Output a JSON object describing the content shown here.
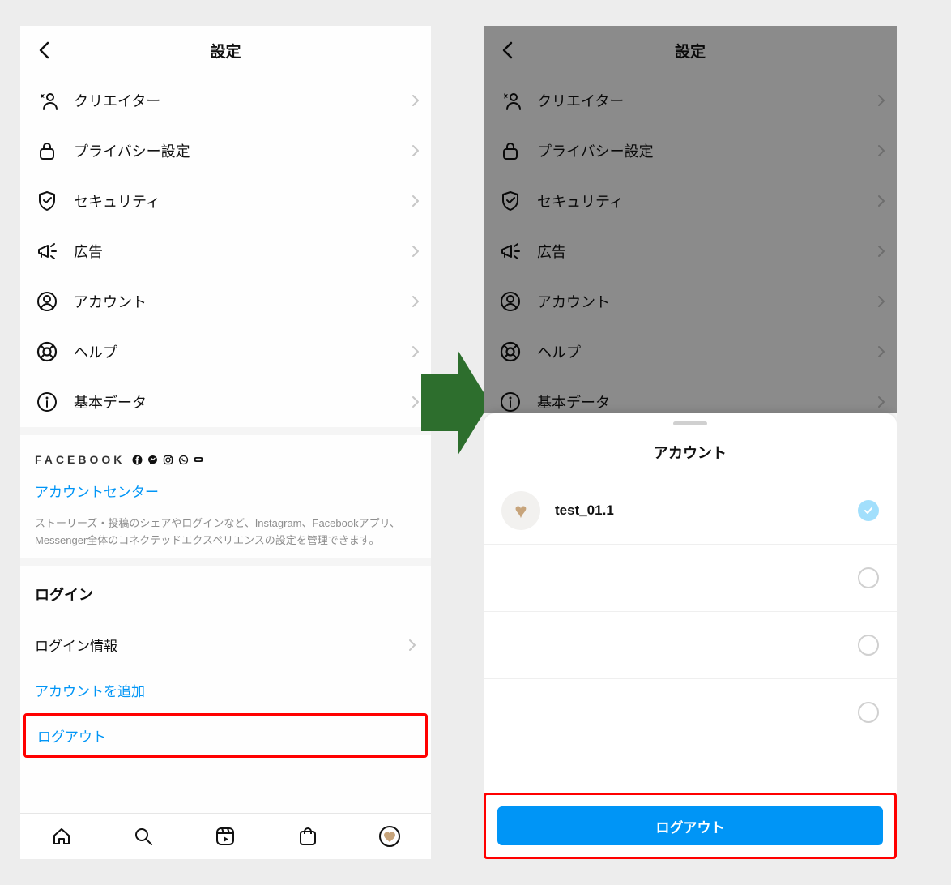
{
  "left": {
    "header_title": "設定",
    "items": [
      {
        "label": "クリエイター",
        "icon": "star-person"
      },
      {
        "label": "プライバシー設定",
        "icon": "lock"
      },
      {
        "label": "セキュリティ",
        "icon": "shield"
      },
      {
        "label": "広告",
        "icon": "megaphone"
      },
      {
        "label": "アカウント",
        "icon": "account"
      },
      {
        "label": "ヘルプ",
        "icon": "help"
      },
      {
        "label": "基本データ",
        "icon": "info"
      }
    ],
    "facebook_label": "FACEBOOK",
    "account_center_link": "アカウントセンター",
    "account_center_desc": "ストーリーズ・投稿のシェアやログインなど、Instagram、Facebookアプリ、Messenger全体のコネクテッドエクスペリエンスの設定を管理できます。",
    "login_section_title": "ログイン",
    "login_info_label": "ログイン情報",
    "add_account_label": "アカウントを追加",
    "logout_label": "ログアウト"
  },
  "right": {
    "header_title": "設定",
    "items": [
      {
        "label": "クリエイター",
        "icon": "star-person"
      },
      {
        "label": "プライバシー設定",
        "icon": "lock"
      },
      {
        "label": "セキュリティ",
        "icon": "shield"
      },
      {
        "label": "広告",
        "icon": "megaphone"
      },
      {
        "label": "アカウント",
        "icon": "account"
      },
      {
        "label": "ヘルプ",
        "icon": "help"
      },
      {
        "label": "基本データ",
        "icon": "info"
      }
    ],
    "sheet": {
      "title": "アカウント",
      "accounts": [
        {
          "name": "test_01.1",
          "selected": true
        },
        {
          "name": "",
          "selected": false
        },
        {
          "name": "",
          "selected": false
        },
        {
          "name": "",
          "selected": false
        }
      ],
      "logout_button": "ログアウト"
    }
  }
}
